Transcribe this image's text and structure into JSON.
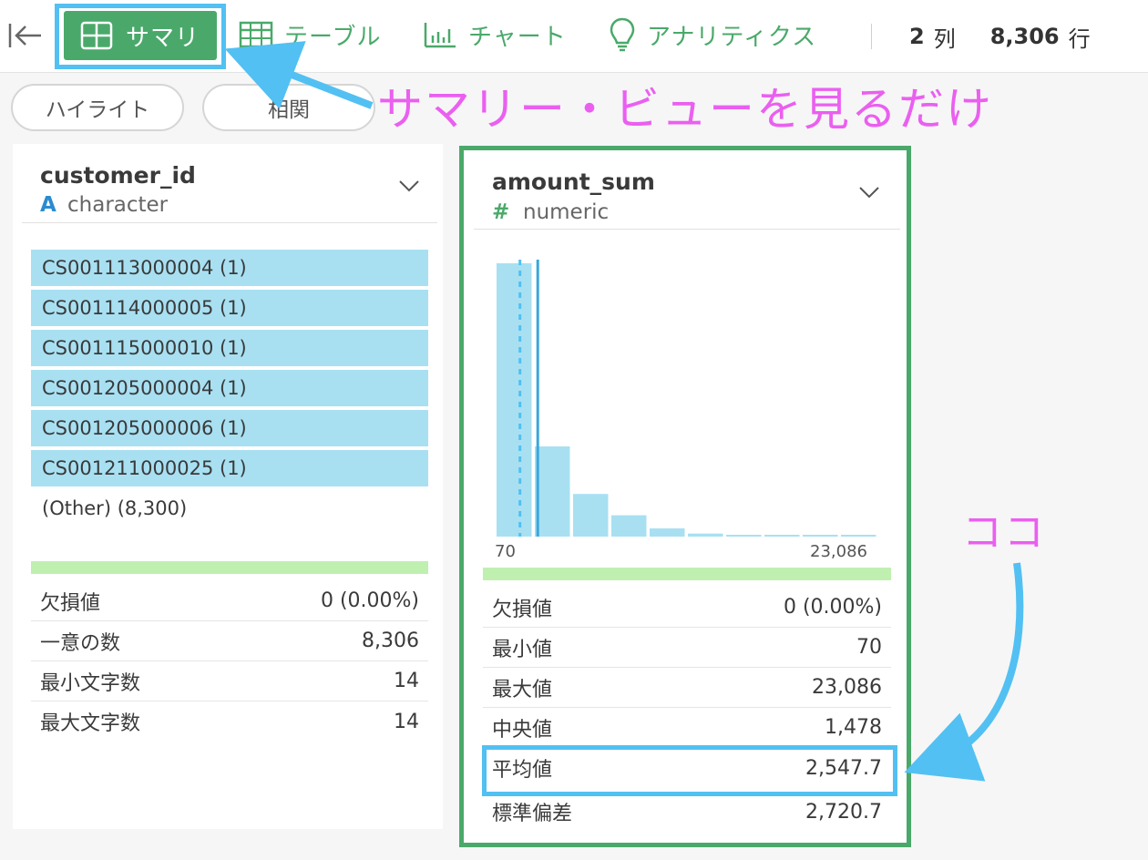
{
  "toolbar": {
    "back_icon": "collapse-left-icon",
    "tabs": [
      {
        "label": "サマリ",
        "icon": "grid-icon",
        "active": true
      },
      {
        "label": "テーブル",
        "icon": "table-icon"
      },
      {
        "label": "チャート",
        "icon": "bar-chart-icon"
      },
      {
        "label": "アナリティクス",
        "icon": "lightbulb-icon"
      }
    ],
    "columns_count": "2",
    "columns_unit": "列",
    "rows_count": "8,306",
    "rows_unit": "行"
  },
  "pills": {
    "highlight": "ハイライト",
    "correlation": "相関"
  },
  "colors": {
    "accent_green": "#4aa96a",
    "callout_blue": "#52c0f2",
    "annotation_pink": "#ea5ff0",
    "bar_blue": "#a8e0f2",
    "strip_green": "#bff0b0"
  },
  "customer_card": {
    "name": "customer_id",
    "type_badge": "A",
    "type": "character",
    "top_values": [
      "CS001113000004 (1)",
      "CS001114000005 (1)",
      "CS001115000010 (1)",
      "CS001205000004 (1)",
      "CS001205000006 (1)",
      "CS001211000025 (1)"
    ],
    "other": "(Other) (8,300)",
    "stats": [
      {
        "label": "欠損値",
        "value": "0 (0.00%)"
      },
      {
        "label": "一意の数",
        "value": "8,306"
      },
      {
        "label": "最小文字数",
        "value": "14"
      },
      {
        "label": "最大文字数",
        "value": "14"
      }
    ]
  },
  "amount_card": {
    "name": "amount_sum",
    "type_badge": "#",
    "type": "numeric",
    "stats": [
      {
        "label": "欠損値",
        "value": "0 (0.00%)"
      },
      {
        "label": "最小値",
        "value": "70"
      },
      {
        "label": "最大値",
        "value": "23,086"
      },
      {
        "label": "中央値",
        "value": "1,478"
      },
      {
        "label": "平均値",
        "value": "2,547.7"
      },
      {
        "label": "標準偏差",
        "value": "2,720.7"
      }
    ]
  },
  "chart_data": {
    "type": "bar",
    "xlim_labels": [
      "70",
      "23,086"
    ],
    "bin_counts": [
      5000,
      1650,
      780,
      390,
      150,
      55,
      25,
      15,
      8,
      4
    ],
    "median": 1478,
    "mean": 2547.7,
    "min": 70,
    "max": 23086
  },
  "annotations": {
    "main": "サマリー・ビューを見るだけ",
    "pointer": "ココ"
  }
}
